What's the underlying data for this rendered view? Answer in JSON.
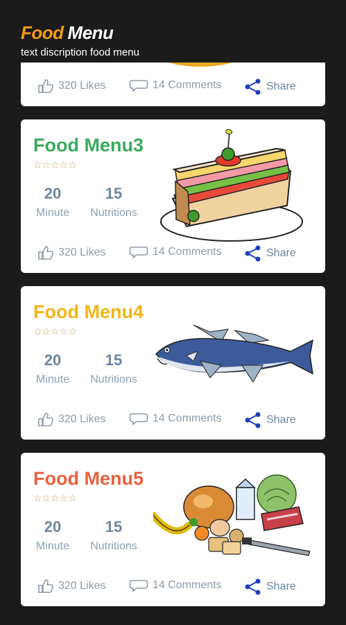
{
  "header": {
    "title_part1": "Food",
    "title_part2": "Menu",
    "subtitle": "text discription food menu"
  },
  "colors": {
    "background": "#1b1b1b",
    "card": "#ffffff",
    "menu3": "#3aaa5c",
    "menu4": "#f2b416",
    "menu5": "#e8613d",
    "share_icon": "#1f3fbf"
  },
  "cards": [
    {
      "likes": "320 Likes",
      "comments": "14 Comments",
      "share": "Share"
    },
    {
      "title": "Food Menu3",
      "time_value": "20",
      "time_label": "Minute",
      "nutr_value": "15",
      "nutr_label": "Nutritions",
      "likes": "320 Likes",
      "comments": "14 Comments",
      "share": "Share",
      "image": "sandwich"
    },
    {
      "title": "Food Menu4",
      "time_value": "20",
      "time_label": "Minute",
      "nutr_value": "15",
      "nutr_label": "Nutritions",
      "likes": "320 Likes",
      "comments": "14 Comments",
      "share": "Share",
      "image": "fish"
    },
    {
      "title": "Food Menu5",
      "time_value": "20",
      "time_label": "Minute",
      "nutr_value": "15",
      "nutr_label": "Nutritions",
      "likes": "320 Likes",
      "comments": "14 Comments",
      "share": "Share",
      "image": "groceries"
    }
  ],
  "stars": "☆☆☆☆☆"
}
